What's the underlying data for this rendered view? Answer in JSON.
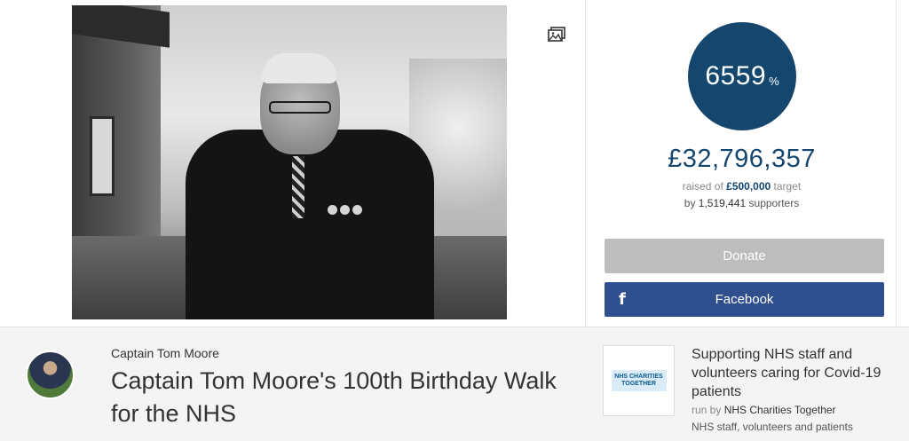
{
  "media": {
    "gallery_icon": "image-gallery-icon"
  },
  "progress": {
    "percent_value": "6559",
    "percent_sign": "%",
    "amount_raised": "£32,796,357",
    "raised_of_label": "raised of",
    "target_amount": "£500,000",
    "target_label": "target",
    "by_label": "by",
    "supporters_count": "1,519,441",
    "supporters_label": "supporters"
  },
  "actions": {
    "donate_label": "Donate",
    "facebook_label": "Facebook",
    "facebook_icon": "f"
  },
  "campaign": {
    "organiser": "Captain Tom Moore",
    "title": "Captain Tom Moore's 100th Birthday Walk for the NHS"
  },
  "charity": {
    "logo_text": "NHS CHARITIES TOGETHER",
    "title": "Supporting NHS staff and volunteers caring for Covid-19 patients",
    "run_by_label": "run by",
    "run_by_name": "NHS Charities Together",
    "description": "NHS staff, volunteers and patients"
  },
  "colors": {
    "brand_navy": "#14466e",
    "facebook_blue": "#2f4f8f",
    "donate_disabled": "#bdbdbd"
  }
}
